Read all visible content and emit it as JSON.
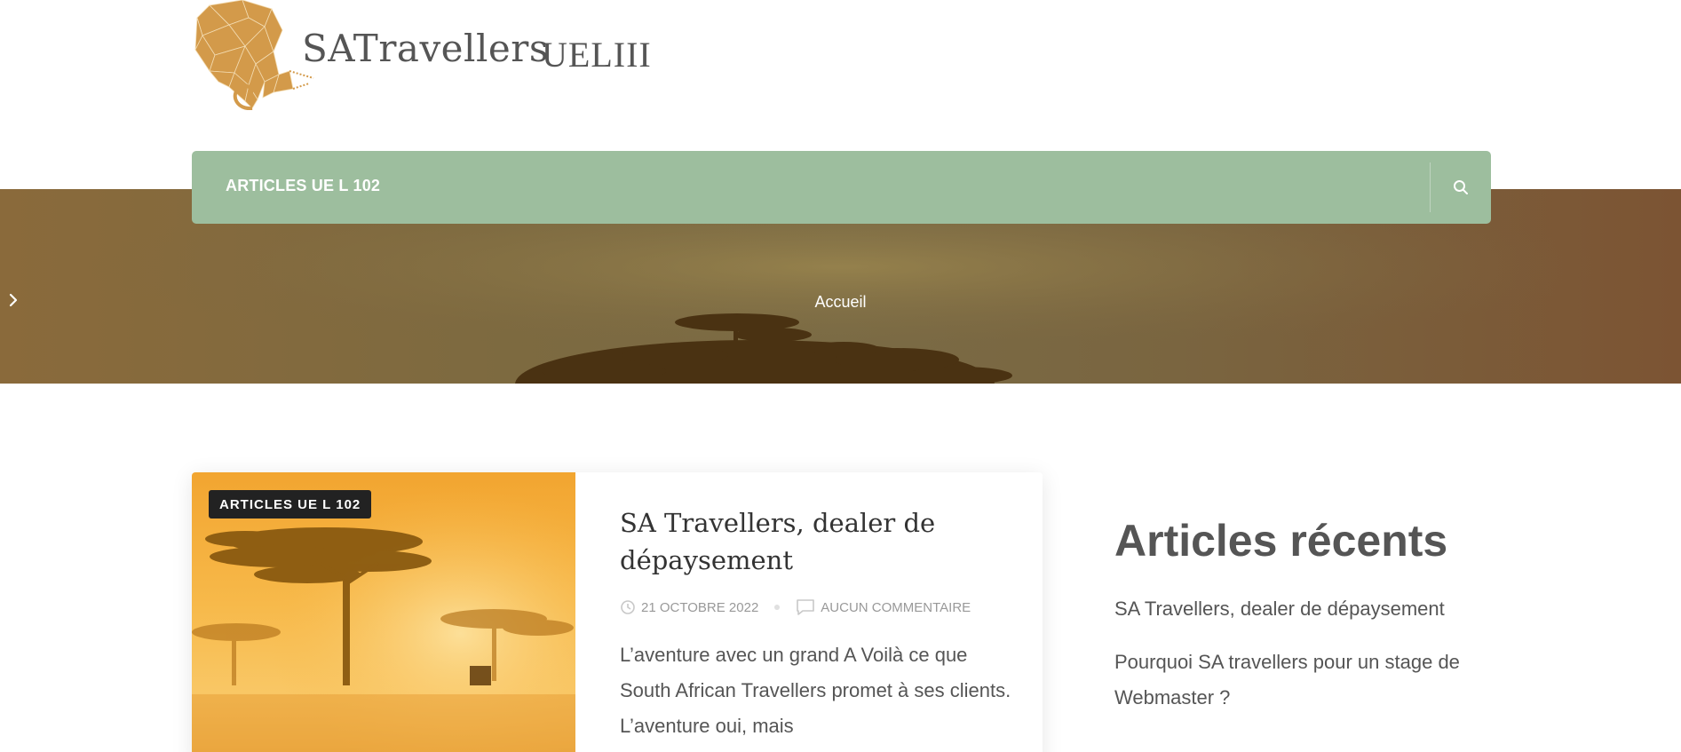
{
  "header": {
    "site_title": "SATravellers",
    "tagline": "UELIII"
  },
  "nav": {
    "items": [
      {
        "label": "ARTICLES UE L 102"
      }
    ],
    "search_icon": "search-icon"
  },
  "breadcrumb": {
    "home_label": "Accueil",
    "separator_icon": "chevron-right-icon"
  },
  "post": {
    "category_badge": "ARTICLES UE L 102",
    "title": "SA Travellers, dealer de dépaysement",
    "date": "21 OCTOBRE 2022",
    "comments": "AUCUN COMMENTAIRE",
    "excerpt": "L’aventure avec un grand A Voilà ce que South African Travellers promet à ses clients. L’aventure oui, mais"
  },
  "sidebar": {
    "title": "Articles récents",
    "items": [
      {
        "label": "SA Travellers, dealer de dépaysement"
      },
      {
        "label": "Pourquoi SA travellers pour un stage de Webmaster ?"
      }
    ]
  },
  "colors": {
    "nav_bg": "#9dbe9e",
    "logo_orange": "#d39a4a",
    "badge_bg": "#222222"
  }
}
